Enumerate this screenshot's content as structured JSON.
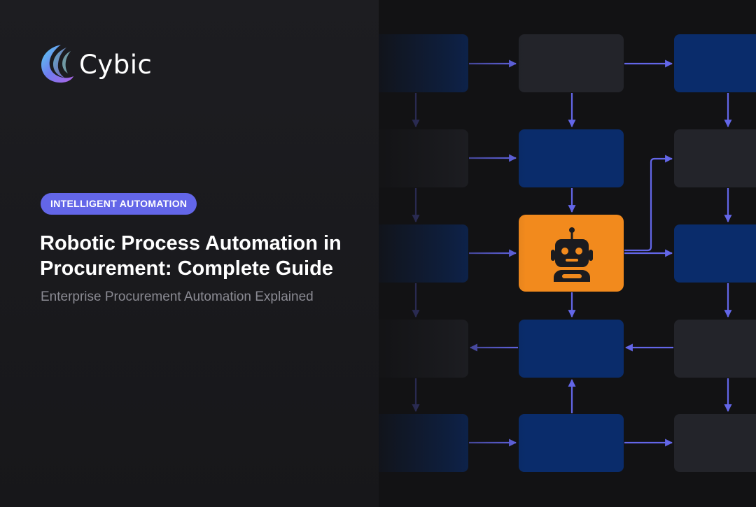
{
  "brand": {
    "name": "Cybic",
    "logo_icon": "crescent-swirl-logo"
  },
  "badge": {
    "label": "INTELLIGENT AUTOMATION"
  },
  "hero": {
    "title": "Robotic Process Automation in Procurement: Complete Guide",
    "subtitle": "Enterprise Procurement Automation Explained"
  },
  "diagram": {
    "center_icon": "robot-icon"
  },
  "colors": {
    "accent": "#6366e8",
    "node_blue": "#0a2c6b",
    "node_gray": "#23242a",
    "node_highlight": "#f28a1d",
    "connector": "#6366e8"
  }
}
